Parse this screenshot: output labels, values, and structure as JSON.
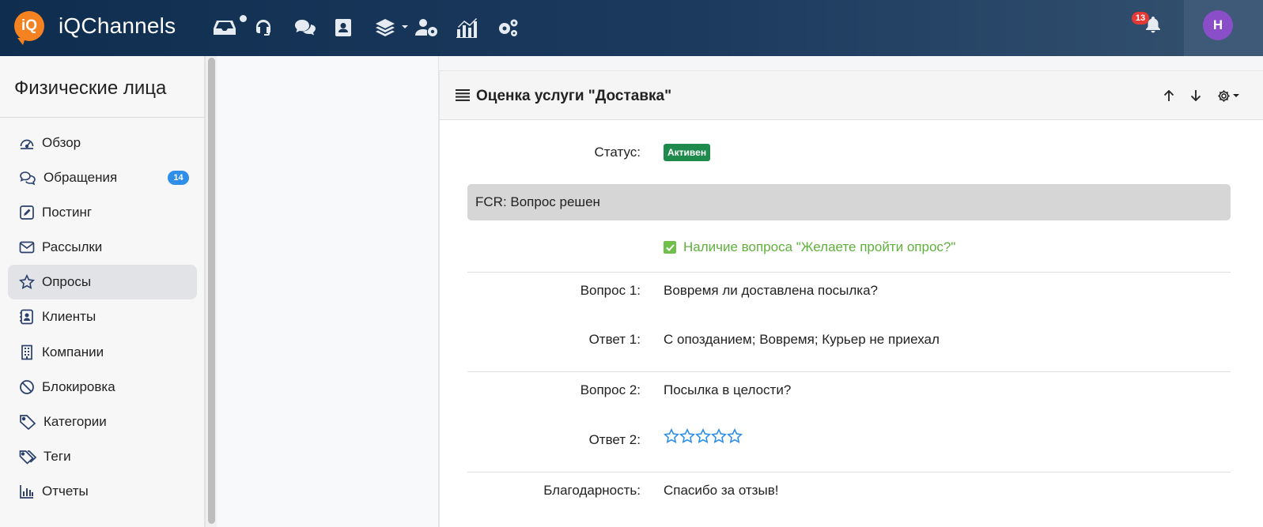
{
  "app": {
    "name": "iQChannels",
    "logo_text": "iQ"
  },
  "topbar": {
    "nav_icons": [
      "inbox-icon",
      "headset-icon",
      "chat-icon",
      "contacts-icon",
      "layers-icon",
      "user-settings-icon",
      "analytics-icon",
      "cogs-icon"
    ],
    "notifications_count": "13",
    "avatar_initial": "H"
  },
  "sidebar": {
    "title": "Физические лица",
    "items": [
      {
        "label": "Обзор",
        "icon": "dashboard-icon"
      },
      {
        "label": "Обращения",
        "icon": "comments-icon",
        "badge": "14"
      },
      {
        "label": "Постинг",
        "icon": "edit-icon"
      },
      {
        "label": "Рассылки",
        "icon": "envelope-icon"
      },
      {
        "label": "Опросы",
        "icon": "star-icon",
        "active": true
      },
      {
        "label": "Клиенты",
        "icon": "client-icon"
      },
      {
        "label": "Компании",
        "icon": "building-icon"
      },
      {
        "label": "Блокировка",
        "icon": "block-icon"
      },
      {
        "label": "Категории",
        "icon": "tag-icon"
      },
      {
        "label": "Теги",
        "icon": "tags-icon"
      },
      {
        "label": "Отчеты",
        "icon": "bar-chart-icon"
      }
    ]
  },
  "survey": {
    "title": "Оценка услуги \"Доставка\"",
    "status_label": "Статус:",
    "status_value": "Активен",
    "section_title": "FCR: Вопрос решен",
    "checkbox_label": "Наличие вопроса \"Желаете пройти опрос?\"",
    "checkbox_checked": true,
    "q1_label": "Вопрос 1:",
    "q1_value": "Вовремя ли доставлена посылка?",
    "a1_label": "Ответ 1:",
    "a1_value": "С опозданием; Вовремя; Курьер не приехал",
    "q2_label": "Вопрос 2:",
    "q2_value": "Посылка в целости?",
    "a2_label": "Ответ 2:",
    "a2_stars": 5,
    "thanks_label": "Благодарность:",
    "thanks_value": "Спасибо за отзыв!"
  },
  "colors": {
    "topbar": "#0f2e4f",
    "accent_orange": "#f58220",
    "status_green": "#1e8a4c",
    "check_green": "#5fb03c",
    "star_blue": "#2f8fe8",
    "badge_blue": "#2f8fe8",
    "badge_red": "#e53935",
    "avatar_purple": "#8a4fc8"
  }
}
